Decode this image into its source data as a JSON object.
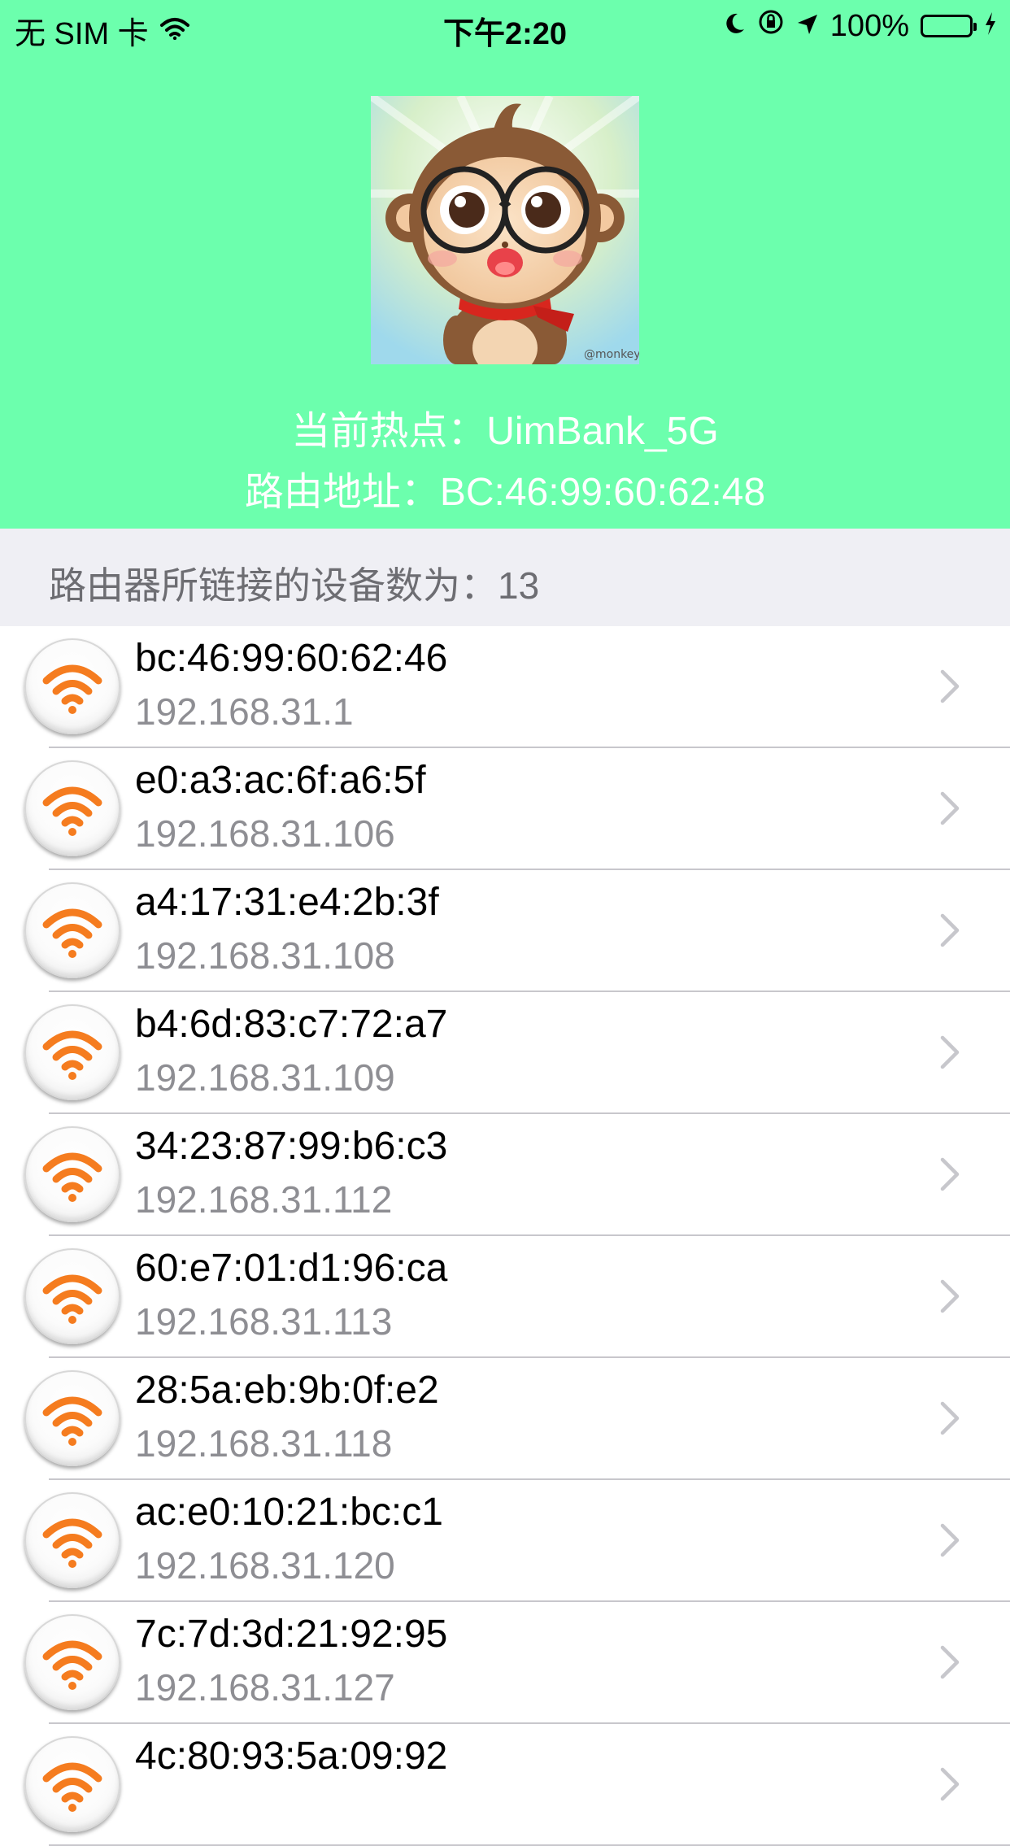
{
  "status_bar": {
    "carrier": "无 SIM 卡",
    "time": "下午2:20",
    "battery": "100%",
    "battery_color": "#43d33a"
  },
  "header": {
    "background_color": "#6cffad",
    "hotspot_text": "当前热点：UimBank_5G",
    "router_text": "路由地址：BC:46:99:60:62:48"
  },
  "section": {
    "title": "路由器所链接的设备数为：13"
  },
  "devices": [
    {
      "mac": "bc:46:99:60:62:46",
      "ip": "192.168.31.1"
    },
    {
      "mac": "e0:a3:ac:6f:a6:5f",
      "ip": "192.168.31.106"
    },
    {
      "mac": "a4:17:31:e4:2b:3f",
      "ip": "192.168.31.108"
    },
    {
      "mac": "b4:6d:83:c7:72:a7",
      "ip": "192.168.31.109"
    },
    {
      "mac": "34:23:87:99:b6:c3",
      "ip": "192.168.31.112"
    },
    {
      "mac": "60:e7:01:d1:96:ca",
      "ip": "192.168.31.113"
    },
    {
      "mac": "28:5a:eb:9b:0f:e2",
      "ip": "192.168.31.118"
    },
    {
      "mac": "ac:e0:10:21:bc:c1",
      "ip": "192.168.31.120"
    },
    {
      "mac": "7c:7d:3d:21:92:95",
      "ip": "192.168.31.127"
    },
    {
      "mac": "4c:80:93:5a:09:92",
      "ip": ""
    }
  ],
  "icons": {
    "device_icon": "wifi-icon",
    "row_accessory": "chevron-right-icon",
    "wifi_color": "#f57c1f"
  }
}
